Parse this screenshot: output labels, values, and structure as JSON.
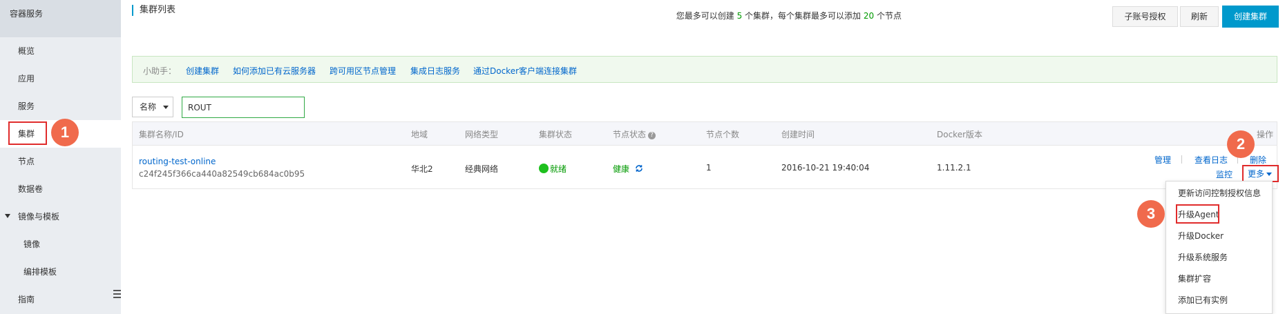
{
  "sidebar": {
    "title": "容器服务",
    "items": [
      {
        "label": "概览"
      },
      {
        "label": "应用"
      },
      {
        "label": "服务"
      },
      {
        "label": "集群"
      },
      {
        "label": "节点"
      },
      {
        "label": "数据卷"
      },
      {
        "label": "镜像与模板"
      },
      {
        "label": "镜像"
      },
      {
        "label": "编排模板"
      },
      {
        "label": "指南"
      }
    ]
  },
  "annotations": {
    "step1": "1",
    "step2": "2",
    "step3": "3"
  },
  "header": {
    "title": "集群列表",
    "quota_prefix": "您最多可以创建",
    "quota_clusters": "5",
    "quota_middle": "个集群，每个集群最多可以添加",
    "quota_nodes": "20",
    "quota_suffix": "个节点",
    "btn_subaccount": "子账号授权",
    "btn_refresh": "刷新",
    "btn_create": "创建集群"
  },
  "helper": {
    "label": "小助手：",
    "links": [
      "创建集群",
      "如何添加已有云服务器",
      "跨可用区节点管理",
      "集成日志服务",
      "通过Docker客户端连接集群"
    ]
  },
  "filter": {
    "field": "名称",
    "value": "ROUT"
  },
  "table": {
    "headers": [
      "集群名称/ID",
      "地域",
      "网络类型",
      "集群状态",
      "节点状态",
      "节点个数",
      "创建时间",
      "Docker版本",
      "操作"
    ],
    "rows": [
      {
        "name": "routing-test-online",
        "id": "c24f245f366ca440a82549cb684ac0b95",
        "region": "华北2",
        "network": "经典网络",
        "cluster_status": "就绪",
        "node_status": "健康",
        "node_count": "1",
        "created": "2016-10-21 19:40:04",
        "docker_version": "1.11.2.1",
        "ops": {
          "manage": "管理",
          "logs": "查看日志",
          "delete": "删除",
          "monitor": "监控",
          "more": "更多"
        }
      }
    ]
  },
  "more_menu": [
    "更新访问控制授权信息",
    "升级Agent",
    "升级Docker",
    "升级系统服务",
    "集群扩容",
    "添加已有实例"
  ],
  "colors": {
    "accent": "#0099cc",
    "link": "#0066cc",
    "success": "#1ec01e",
    "highlight": "#e02b2b",
    "badge": "#f06a4c"
  }
}
